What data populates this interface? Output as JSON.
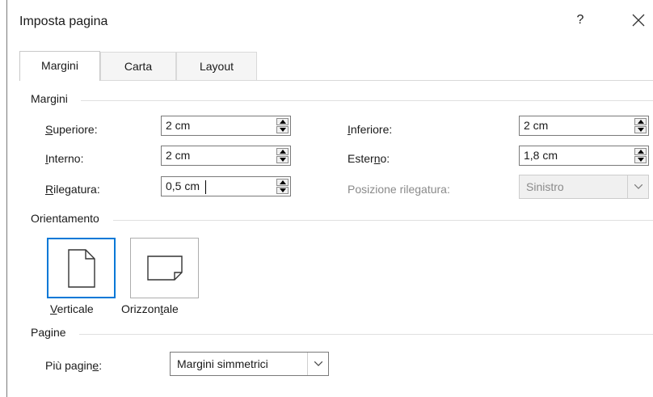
{
  "window": {
    "title": "Imposta pagina",
    "help_label": "?"
  },
  "tabs": [
    {
      "label": "Margini",
      "active": true
    },
    {
      "label": "Carta",
      "active": false
    },
    {
      "label": "Layout",
      "active": false
    }
  ],
  "margins": {
    "group_label": "Margini",
    "top": {
      "label_ul": "S",
      "label_rest": "uperiore:",
      "value": "2 cm"
    },
    "bottom": {
      "label_ul": "I",
      "label_rest": "nferiore:",
      "value": "2 cm"
    },
    "inner": {
      "label_ul": "I",
      "label_rest": "nterno:",
      "value": "2 cm"
    },
    "outer": {
      "label_pre": "Ester",
      "label_ul": "n",
      "label_rest": "o:",
      "value": "1,8 cm"
    },
    "gutter": {
      "label_ul": "R",
      "label_rest": "ilegatura:",
      "value": "0,5 cm"
    },
    "gutter_position": {
      "label": "Posizione rilegatura:",
      "value": "Sinistro",
      "disabled": true
    }
  },
  "orientation": {
    "group_label": "Orientamento",
    "portrait": {
      "label_ul": "V",
      "label_rest": "erticale",
      "selected": true
    },
    "landscape": {
      "label_pre": "Orizzon",
      "label_ul": "t",
      "label_rest": "ale",
      "selected": false
    }
  },
  "pages": {
    "group_label": "Pagine",
    "multiple": {
      "label_pre": "Più pagin",
      "label_ul": "e",
      "label_rest": ":",
      "value": "Margini simmetrici"
    }
  },
  "colors": {
    "accent": "#0078d7",
    "disabled_text": "#8a8a8a",
    "border": "#7a7a7a"
  }
}
